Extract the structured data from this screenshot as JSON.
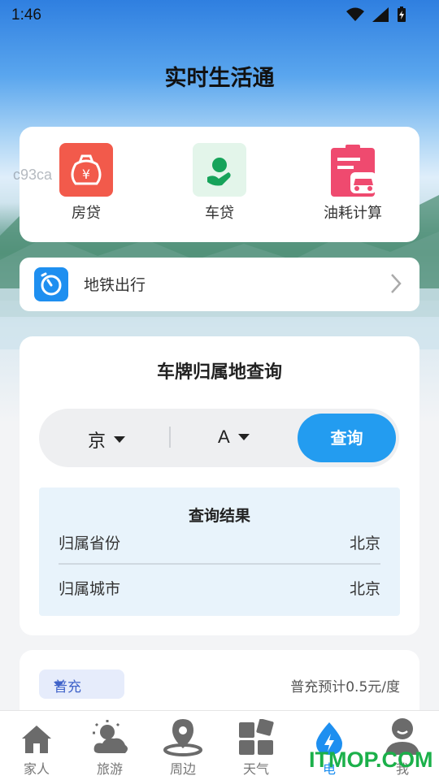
{
  "status_bar": {
    "time": "1:46"
  },
  "page_title": "实时生活通",
  "watermark": "c93ca",
  "tools": [
    {
      "label": "房贷",
      "icon": "money-bag-icon",
      "color": "#f25a4b"
    },
    {
      "label": "车贷",
      "icon": "car-loan-icon",
      "color": "#16a35a"
    },
    {
      "label": "油耗计算",
      "icon": "fuel-calculator-icon",
      "color": "#ef4a6f"
    }
  ],
  "metro": {
    "label": "地铁出行",
    "icon": "metro-icon"
  },
  "plate_query": {
    "title": "车牌归属地查询",
    "province": "京",
    "letter": "A",
    "button": "查询",
    "result": {
      "title": "查询结果",
      "rows": [
        {
          "label": "归属省份",
          "value": "北京"
        },
        {
          "label": "归属城市",
          "value": "北京"
        }
      ]
    }
  },
  "charging": {
    "type": "普充",
    "note": "普充预计0.5元/度"
  },
  "tabs": [
    {
      "label": "家人",
      "icon": "home-icon"
    },
    {
      "label": "旅游",
      "icon": "sun-cloud-icon"
    },
    {
      "label": "周边",
      "icon": "location-pin-icon"
    },
    {
      "label": "天气",
      "icon": "grid-icon"
    },
    {
      "label": "电",
      "icon": "lightning-drop-icon"
    },
    {
      "label": "我",
      "icon": "person-icon"
    }
  ],
  "logo_text": "ITMOP.COM",
  "colors": {
    "accent": "#239cf0",
    "result_bg": "#e8f3fb",
    "logo": "#1bb04a"
  }
}
